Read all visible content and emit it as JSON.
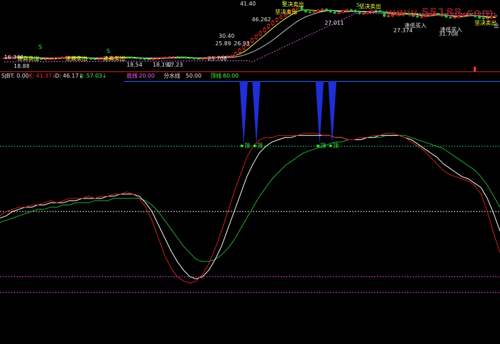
{
  "watermark": "www.55188.com",
  "colors": {
    "background": "#000000",
    "up": "#ff3030",
    "down": "#20c040",
    "separator": "#d02020",
    "level_line_top": "#2a62ff",
    "k_line": "#d02020",
    "d_line": "#ffffff",
    "j_line": "#20b030",
    "spike": "#1e2fd8",
    "upper_band": "#e060e0",
    "ma_line": "#ffff40",
    "ma_line2": "#c8c8c8",
    "green_dashed": "#20c060",
    "white_dotted": "#e8e8e8",
    "magenta_dashed": "#e040e0",
    "label_yellow": "#ffff40",
    "label_white": "#e8e8e8",
    "label_green": "#40ff40",
    "label_magenta": "#ff60ff"
  },
  "chart_data": [
    {
      "type": "candlestick",
      "price_labels": [
        {
          "text": "41.40",
          "color": "label_white"
        },
        {
          "text": "46.262",
          "color": "label_white"
        },
        {
          "text": "27.011",
          "color": "label_white"
        },
        {
          "text": "27.374",
          "color": "label_white"
        },
        {
          "text": "31.708",
          "color": "label_white"
        },
        {
          "text": "30.40",
          "color": "label_white"
        },
        {
          "text": "25.89",
          "color": "label_white"
        },
        {
          "text": "26.93",
          "color": "label_white"
        },
        {
          "text": "25.708",
          "color": "label_white"
        },
        {
          "text": "18.54",
          "color": "label_white"
        },
        {
          "text": "18.192",
          "color": "label_white"
        },
        {
          "text": "17.23",
          "color": "label_white"
        },
        {
          "text": "18.88",
          "color": "label_white"
        },
        {
          "text": "16.344",
          "color": "label_white"
        }
      ],
      "signal_labels": [
        {
          "text": "逢高卖出",
          "color": "label_yellow"
        },
        {
          "text": "逢高卖出",
          "color": "label_yellow"
        },
        {
          "text": "逢高卖出",
          "color": "label_yellow"
        },
        {
          "text": "坚决卖出",
          "color": "label_yellow"
        },
        {
          "text": "坚决卖出",
          "color": "label_yellow"
        },
        {
          "text": "坚决卖出",
          "color": "label_yellow"
        },
        {
          "text": "坚决卖出",
          "color": "label_yellow"
        },
        {
          "text": "逢低买入",
          "color": "label_white"
        },
        {
          "text": "逢低买入",
          "color": "label_white"
        },
        {
          "text": "止",
          "color": "label_white"
        }
      ],
      "markers": [
        "S",
        "S",
        "S",
        "S"
      ]
    },
    {
      "type": "line",
      "header": [
        {
          "text": "SJBT: 0.00",
          "color": "label_white"
        },
        {
          "text": "K: 41.37",
          "color": "up",
          "arrow": "↓"
        },
        {
          "text": "D: 46.17",
          "color": "label_white",
          "arrow": "↓"
        },
        {
          "text": "J: 57.03",
          "color": "label_green",
          "arrow": "↓"
        }
      ],
      "levels_legend": [
        {
          "name": "底线",
          "value": "20.00",
          "color": "label_magenta"
        },
        {
          "name": "分水线",
          "value": "50.00",
          "color": "label_white"
        },
        {
          "name": "顶线",
          "value": "80.00",
          "color": "label_green"
        }
      ],
      "levels": [
        20,
        50,
        80
      ],
      "top_marker_label": "★顶",
      "top_marker_count": 4,
      "ylim": [
        -10,
        110
      ],
      "series": [
        {
          "name": "K",
          "color": "k_line",
          "values": [
            48,
            50,
            51,
            52,
            52,
            53,
            53,
            54,
            55,
            54,
            55,
            56,
            56,
            56,
            57,
            56,
            57,
            57,
            58,
            58,
            59,
            58,
            56,
            52,
            46,
            38,
            30,
            24,
            20,
            18,
            17,
            18,
            21,
            26,
            33,
            41,
            50,
            59,
            67,
            75,
            80,
            83,
            84,
            84,
            85,
            85,
            85,
            85,
            86,
            86,
            86,
            85,
            85,
            84,
            84,
            83,
            83,
            84,
            84,
            85,
            85,
            86,
            86,
            85,
            84,
            82,
            80,
            78,
            75,
            72,
            69,
            67,
            66,
            65,
            64,
            62,
            58,
            50,
            40,
            31
          ]
        },
        {
          "name": "D",
          "color": "d_line",
          "values": [
            47,
            48,
            50,
            51,
            52,
            52,
            53,
            53,
            54,
            54,
            54,
            55,
            55,
            56,
            56,
            56,
            56,
            57,
            57,
            58,
            58,
            58,
            57,
            54,
            50,
            44,
            38,
            32,
            27,
            23,
            20,
            19,
            20,
            23,
            28,
            34,
            42,
            50,
            58,
            66,
            72,
            77,
            80,
            82,
            83,
            84,
            84,
            85,
            85,
            85,
            85,
            85,
            85,
            84,
            84,
            83,
            83,
            83,
            84,
            84,
            85,
            85,
            85,
            85,
            84,
            83,
            81,
            79,
            77,
            75,
            72,
            70,
            68,
            66,
            65,
            63,
            61,
            56,
            49,
            41
          ]
        },
        {
          "name": "J",
          "color": "j_line",
          "values": [
            45,
            46,
            47,
            48,
            49,
            50,
            51,
            51,
            52,
            52,
            53,
            53,
            54,
            54,
            54,
            55,
            55,
            55,
            56,
            56,
            56,
            56,
            56,
            55,
            53,
            50,
            46,
            42,
            38,
            34,
            31,
            28,
            27,
            27,
            28,
            30,
            33,
            37,
            42,
            47,
            52,
            57,
            61,
            65,
            68,
            71,
            73,
            75,
            77,
            78,
            79,
            80,
            81,
            82,
            82,
            83,
            83,
            83,
            84,
            84,
            84,
            85,
            85,
            85,
            85,
            84,
            83,
            82,
            81,
            80,
            79,
            77,
            75,
            73,
            71,
            69,
            66,
            62,
            57,
            52
          ]
        }
      ],
      "spikes_at": [
        38.5,
        40.5,
        50.5,
        52.5
      ]
    }
  ]
}
